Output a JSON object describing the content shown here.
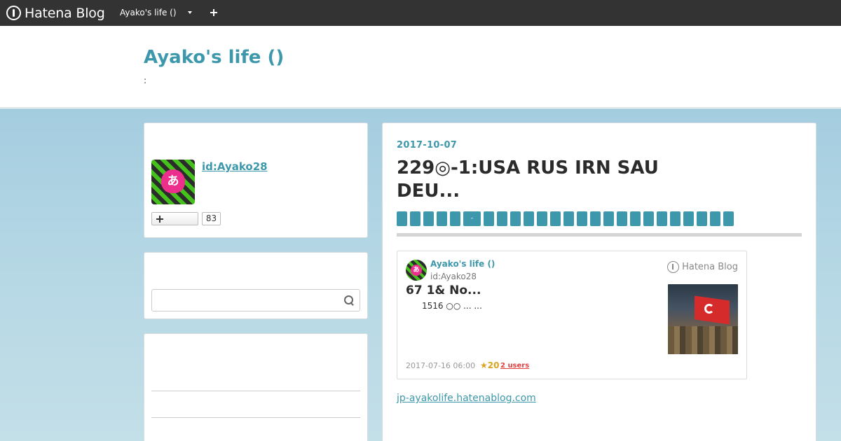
{
  "topbar": {
    "brand": "Hatena Blog",
    "blog_switch": "Ayako's life ()",
    "plus_label": "+"
  },
  "header": {
    "title": "Ayako's life ()",
    "description": ":"
  },
  "profile": {
    "avatar_char": "あ",
    "user_id": "id:Ayako28",
    "follower_count": "83"
  },
  "search": {
    "placeholder": ""
  },
  "article": {
    "date": "2017-10-07",
    "title": "229◎-1:USA RUS IRN SAU DEU...",
    "categories": [
      "",
      "",
      "",
      "",
      "",
      "-",
      "",
      "",
      "",
      "",
      "",
      "",
      "",
      "",
      "",
      "",
      "",
      "",
      "",
      "",
      "",
      "",
      "",
      "",
      ""
    ],
    "link_text": "jp-ayakolife.hatenablog.com"
  },
  "embed": {
    "blog_name": "Ayako's life ()",
    "user_id": "id:Ayako28",
    "logo_text": "Hatena Blog",
    "avatar_char": "あ",
    "title": "67 1&  No...",
    "snippet": "1516 ○○ ... ...",
    "date": "2017-07-16 06:00",
    "stars": "★20",
    "users": "2 users"
  }
}
